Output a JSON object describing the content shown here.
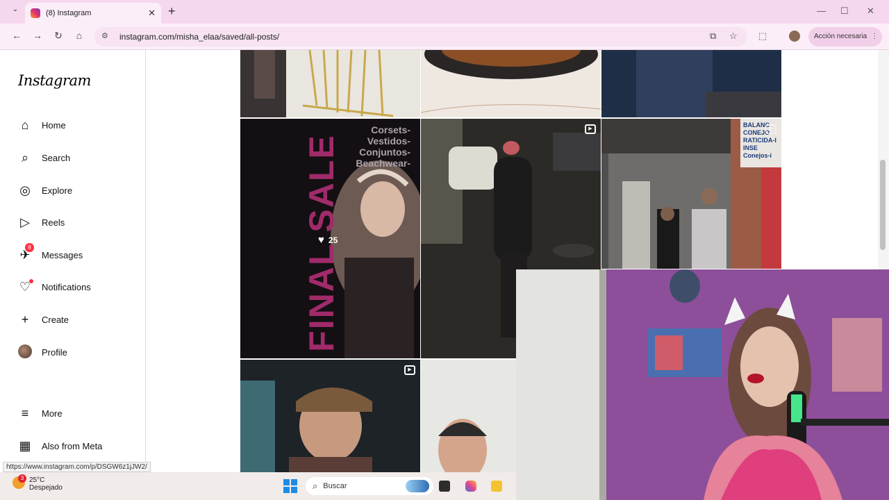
{
  "browser": {
    "tab_title": "(8) Instagram",
    "url": "instagram.com/misha_elaa/saved/all-posts/",
    "action_label": "Acción necesaria"
  },
  "sidebar": {
    "logo": "Instagram",
    "items": [
      {
        "label": "Home",
        "icon": "home-icon"
      },
      {
        "label": "Search",
        "icon": "search-icon"
      },
      {
        "label": "Explore",
        "icon": "compass-icon"
      },
      {
        "label": "Reels",
        "icon": "reels-icon"
      },
      {
        "label": "Messages",
        "icon": "messenger-icon",
        "badge": "8"
      },
      {
        "label": "Notifications",
        "icon": "heart-icon"
      },
      {
        "label": "Create",
        "icon": "plus-icon"
      },
      {
        "label": "Profile",
        "icon": "avatar"
      },
      {
        "label": "More",
        "icon": "menu-icon"
      },
      {
        "label": "Also from Meta",
        "icon": "meta-icon"
      }
    ]
  },
  "grid": {
    "post_final_sale": {
      "text_left": "FINAL SALE",
      "text_right": [
        "Corsets-",
        "Vestidos-",
        "Conjuntos-",
        "Beachwear-"
      ],
      "likes": "25"
    },
    "storefront_sign": [
      "BALANC",
      "CONEJO",
      "RATICIDA-I",
      "INSE",
      "Conejos-i"
    ]
  },
  "status_link": "https://www.instagram.com/p/DSGW6z1jJW2/",
  "taskbar": {
    "weather_badge": "3",
    "temperature": "25°C",
    "condition": "Despejado",
    "search_placeholder": "Buscar"
  },
  "colors": {
    "tabbar": "#f6d8ee",
    "notification_red": "#ff3040",
    "stream_wall": "#8d4f9a"
  }
}
